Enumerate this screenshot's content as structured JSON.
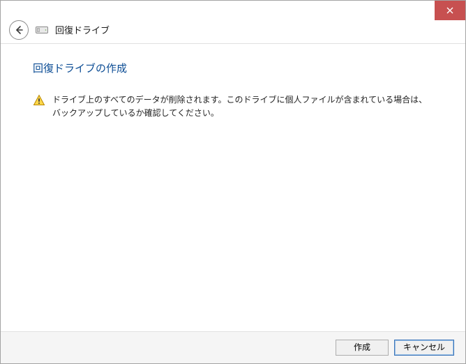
{
  "window": {
    "app_title": "回復ドライブ"
  },
  "page": {
    "title": "回復ドライブの作成",
    "warning_text": "ドライブ上のすべてのデータが削除されます。このドライブに個人ファイルが含まれている場合は、バックアップしているか確認してください。"
  },
  "footer": {
    "create_label": "作成",
    "cancel_label": "キャンセル"
  },
  "icons": {
    "close": "close-icon",
    "back": "back-arrow-icon",
    "drive": "drive-icon",
    "warning": "warning-icon"
  }
}
